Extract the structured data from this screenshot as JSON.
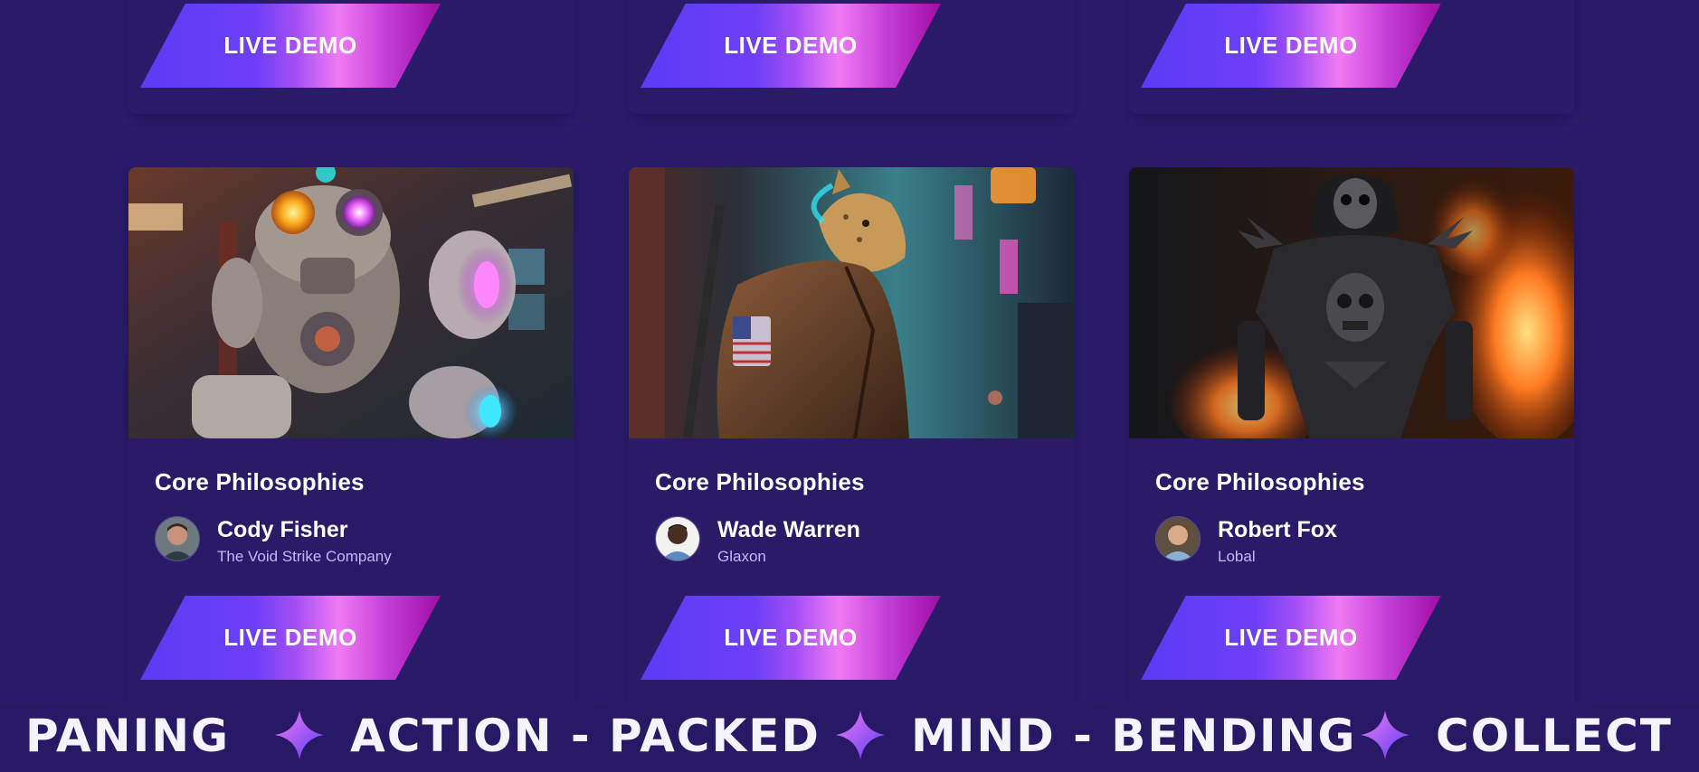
{
  "top_row": [
    {
      "demo_label": "LIVE DEMO"
    },
    {
      "demo_label": "LIVE DEMO"
    },
    {
      "demo_label": "LIVE DEMO"
    }
  ],
  "cards": [
    {
      "title": "Core Philosophies",
      "author": "Cody Fisher",
      "company": "The Void Strike Company",
      "demo_label": "LIVE DEMO",
      "image": "robot-artwork"
    },
    {
      "title": "Core Philosophies",
      "author": "Wade Warren",
      "company": "Glaxon",
      "demo_label": "LIVE DEMO",
      "image": "leopard-soldier-artwork"
    },
    {
      "title": "Core Philosophies",
      "author": "Robert Fox",
      "company": "Lobal",
      "demo_label": "LIVE DEMO",
      "image": "skull-knight-artwork"
    }
  ],
  "marquee": {
    "words": [
      "PANING",
      "ACTION - PACKED",
      "MIND - BENDING",
      "COLLECTI"
    ],
    "separator_icon": "sparkle-star-icon"
  },
  "colors": {
    "background": "#2b1c6b",
    "card": "#2a1b69",
    "company_text": "#c9b2ff",
    "button_gradient": [
      "#5b3cf5",
      "#f07bf4",
      "#a00ea4"
    ]
  }
}
